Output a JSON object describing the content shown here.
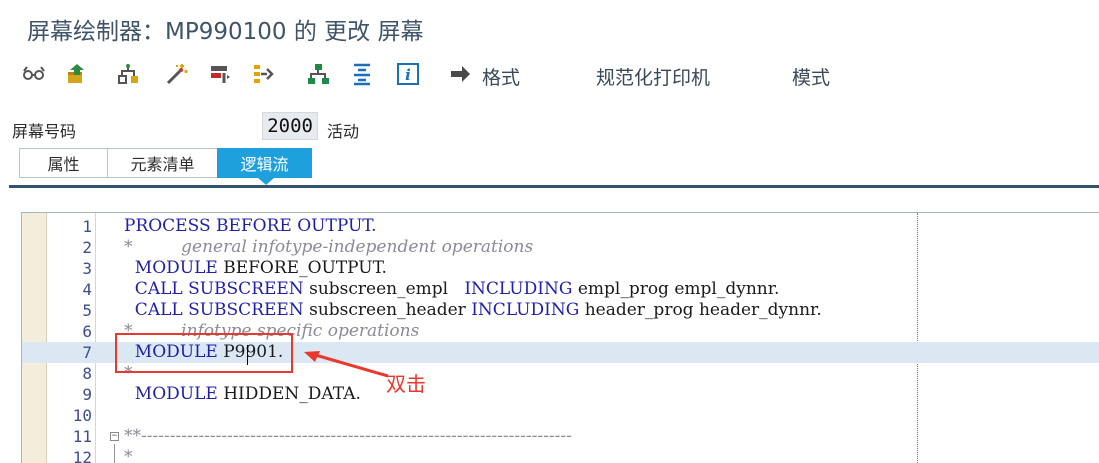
{
  "window": {
    "title": "屏幕绘制器：MP990100 的 更改 屏幕"
  },
  "toolbar": {
    "icons": [
      "glasses-icon",
      "transport-icon",
      "hierarchy-icon",
      "magic-wand-icon",
      "filter-icon",
      "branch-icon",
      "org-chart-icon",
      "align-icon",
      "info-icon"
    ],
    "format_label": "格式",
    "normalized_print_label": "规范化打印机",
    "pattern_label": "模式"
  },
  "screen": {
    "number_label": "屏幕号码",
    "number_value": "2000",
    "status": "活动"
  },
  "tabs": [
    {
      "label": "属性",
      "active": false
    },
    {
      "label": "元素清单",
      "active": false
    },
    {
      "label": "逻辑流",
      "active": true
    }
  ],
  "editor": {
    "lines": [
      {
        "no": "1",
        "parts": [
          [
            "kw",
            "PROCESS BEFORE OUTPUT."
          ]
        ]
      },
      {
        "no": "2",
        "parts": [
          [
            "cm",
            "*         general infotype-independent operations"
          ]
        ]
      },
      {
        "no": "3",
        "parts": [
          [
            "kw",
            "  MODULE "
          ],
          [
            "id",
            "BEFORE_OUTPUT."
          ]
        ]
      },
      {
        "no": "4",
        "parts": [
          [
            "kw",
            "  CALL SUBSCREEN "
          ],
          [
            "id",
            "subscreen_empl   "
          ],
          [
            "kw",
            "INCLUDING "
          ],
          [
            "id",
            "empl_prog empl_dynnr."
          ]
        ]
      },
      {
        "no": "5",
        "parts": [
          [
            "kw",
            "  CALL SUBSCREEN "
          ],
          [
            "id",
            "subscreen_header "
          ],
          [
            "kw",
            "INCLUDING "
          ],
          [
            "id",
            "header_prog header_dynnr."
          ]
        ]
      },
      {
        "no": "6",
        "parts": [
          [
            "cm",
            "*         infotype specific operations"
          ]
        ]
      },
      {
        "no": "7",
        "parts": [
          [
            "kw",
            "  MODULE "
          ],
          [
            "id",
            "P9901."
          ]
        ]
      },
      {
        "no": "8",
        "parts": [
          [
            "cm",
            "*"
          ]
        ]
      },
      {
        "no": "9",
        "parts": [
          [
            "kw",
            "  MODULE "
          ],
          [
            "id",
            "HIDDEN_DATA."
          ]
        ]
      },
      {
        "no": "10",
        "parts": []
      },
      {
        "no": "11",
        "parts": [
          [
            "cm",
            "**---------------------------------------------------------------------------"
          ]
        ]
      },
      {
        "no": "12",
        "parts": [
          [
            "cm",
            "*"
          ]
        ]
      }
    ],
    "highlighted_line": 7
  },
  "annotation": {
    "label": "双击",
    "color": "#e8392f"
  },
  "colors": {
    "accent": "#1ea0dc",
    "rule": "#34526e",
    "keyword": "#1f1fa8",
    "comment": "#8a8a99"
  }
}
